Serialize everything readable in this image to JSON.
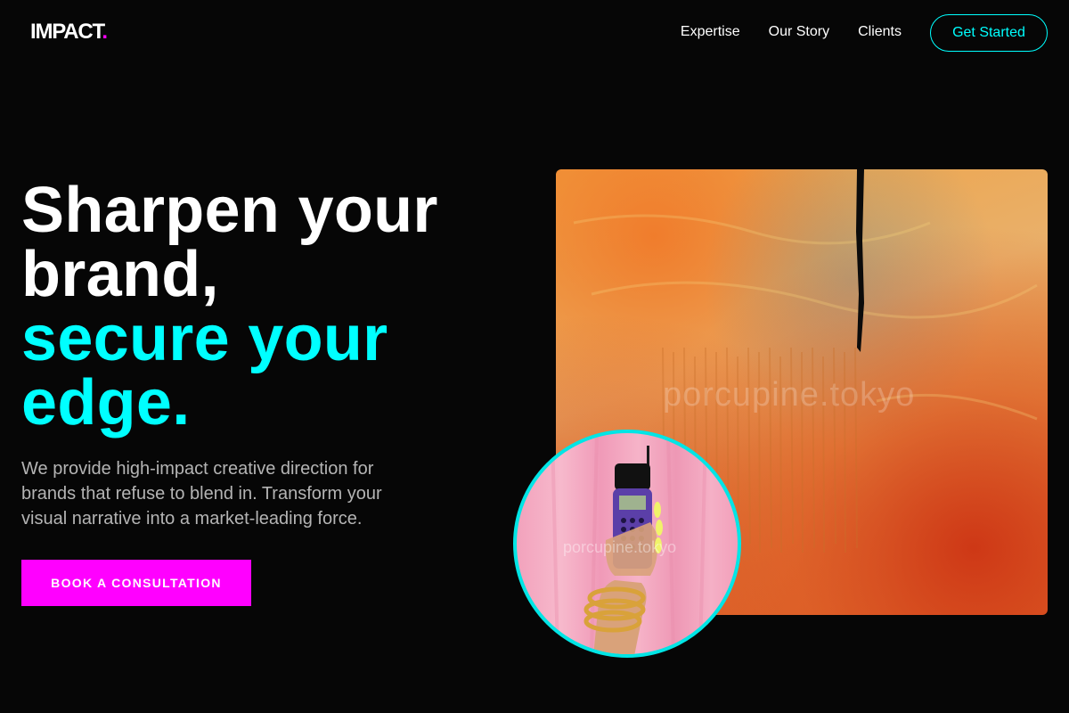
{
  "brand": {
    "name": "IMPACT",
    "dot": ".",
    "accent": "#ff00ff"
  },
  "nav": {
    "items": [
      {
        "label": "Expertise"
      },
      {
        "label": "Our Story"
      },
      {
        "label": "Clients"
      }
    ],
    "cta_label": "Get Started"
  },
  "hero": {
    "line1": "Sharpen your",
    "line2": "brand,",
    "line3": "secure your",
    "line4": "edge.",
    "lede": "We provide high-impact creative direction for brands that refuse to blend in. Transform your visual narrative into a market-leading force.",
    "cta_label": "BOOK A CONSULTATION"
  },
  "images": {
    "art_watermark": "porcupine.tokyo",
    "circle_watermark": "porcupine.tokyo"
  },
  "colors": {
    "background": "#060606",
    "primary_text": "#ffffff",
    "highlight": "#00ffff",
    "accent": "#ff00ff",
    "muted_text": "#b4b4b4"
  }
}
